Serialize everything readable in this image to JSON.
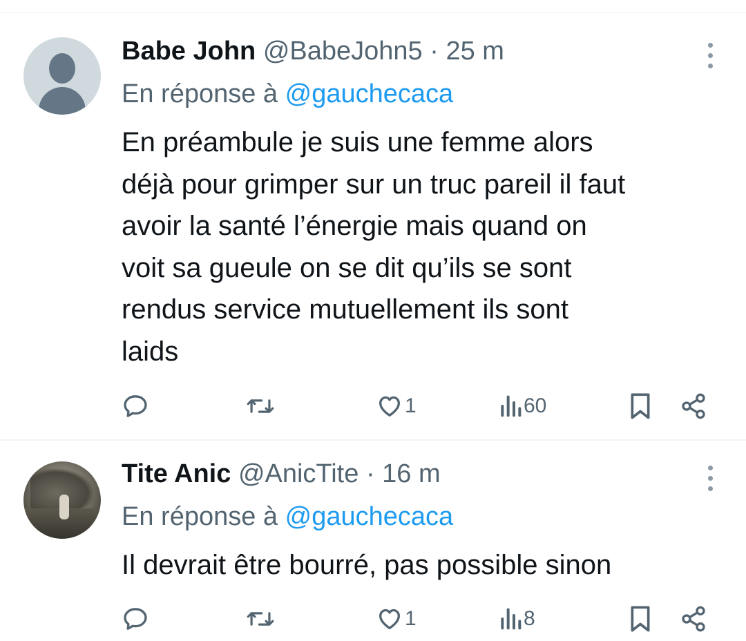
{
  "tweets": [
    {
      "display_name": "Babe John",
      "handle": "@BabeJohn5",
      "separator": "·",
      "time": "25 m",
      "reply_prefix": "En réponse à",
      "reply_to": "@gauchecaca",
      "text_lines": [
        "En préambule je suis une femme alors",
        "déjà pour grimper sur un truc pareil il faut",
        "avoir la santé l’énergie mais quand on",
        "voit sa gueule on se dit qu’ils se sont",
        "rendus service mutuellement ils sont",
        "laids"
      ],
      "avatar": "default-avatar",
      "likes": "1",
      "views": "60"
    },
    {
      "display_name": "Tite Anic",
      "handle": "@AnicTite",
      "separator": "·",
      "time": "16 m",
      "reply_prefix": "En réponse à",
      "reply_to": "@gauchecaca",
      "text_lines": [
        "Il devrait être bourré,  pas possible sinon"
      ],
      "avatar": "photo-avatar",
      "likes": "1",
      "views": "8"
    }
  ],
  "icons": {
    "reply": "reply-icon",
    "retweet": "retweet-icon",
    "like": "heart-icon",
    "views": "views-icon",
    "bookmark": "bookmark-icon",
    "share": "share-icon",
    "more": "more-icon"
  },
  "colors": {
    "text": "#0f1419",
    "secondary": "#536471",
    "link": "#1d9bf0",
    "divider": "#eff3f4"
  }
}
